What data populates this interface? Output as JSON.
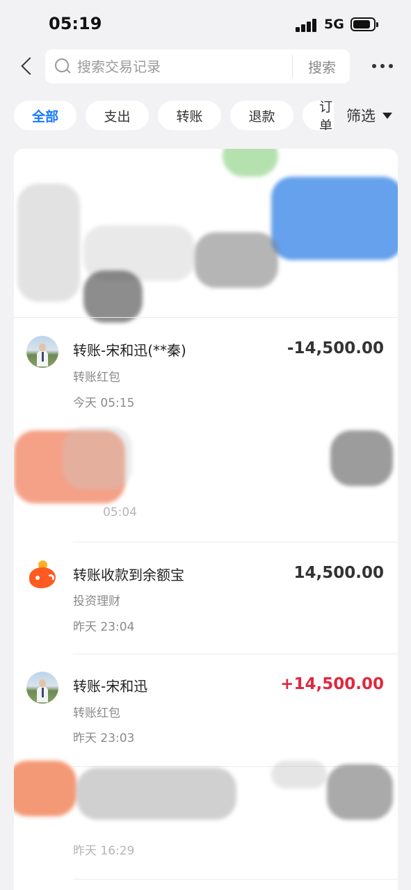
{
  "status_bar": {
    "time": "05:19",
    "network": "5G"
  },
  "search": {
    "placeholder": "搜索交易记录",
    "button_label": "搜索"
  },
  "filters": {
    "chips": [
      "全部",
      "支出",
      "转账",
      "退款",
      "订单"
    ],
    "filter_label": "筛选"
  },
  "transactions": [
    {
      "title": "转账-宋和迅(**秦)",
      "category": "转账红包",
      "time": "今天 05:15",
      "amount": "-14,500.00"
    },
    {
      "time": "05:04"
    },
    {
      "title": "转账收款到余额宝",
      "category": "投资理财",
      "time": "昨天 23:04",
      "amount": "14,500.00"
    },
    {
      "title": "转账-宋和迅",
      "category": "转账红包",
      "time": "昨天 23:03",
      "amount": "+14,500.00"
    },
    {
      "time": "昨天 16:29"
    }
  ],
  "colors": {
    "accent": "#1677ff",
    "income": "#e0283f",
    "background": "#f2f2f4"
  }
}
